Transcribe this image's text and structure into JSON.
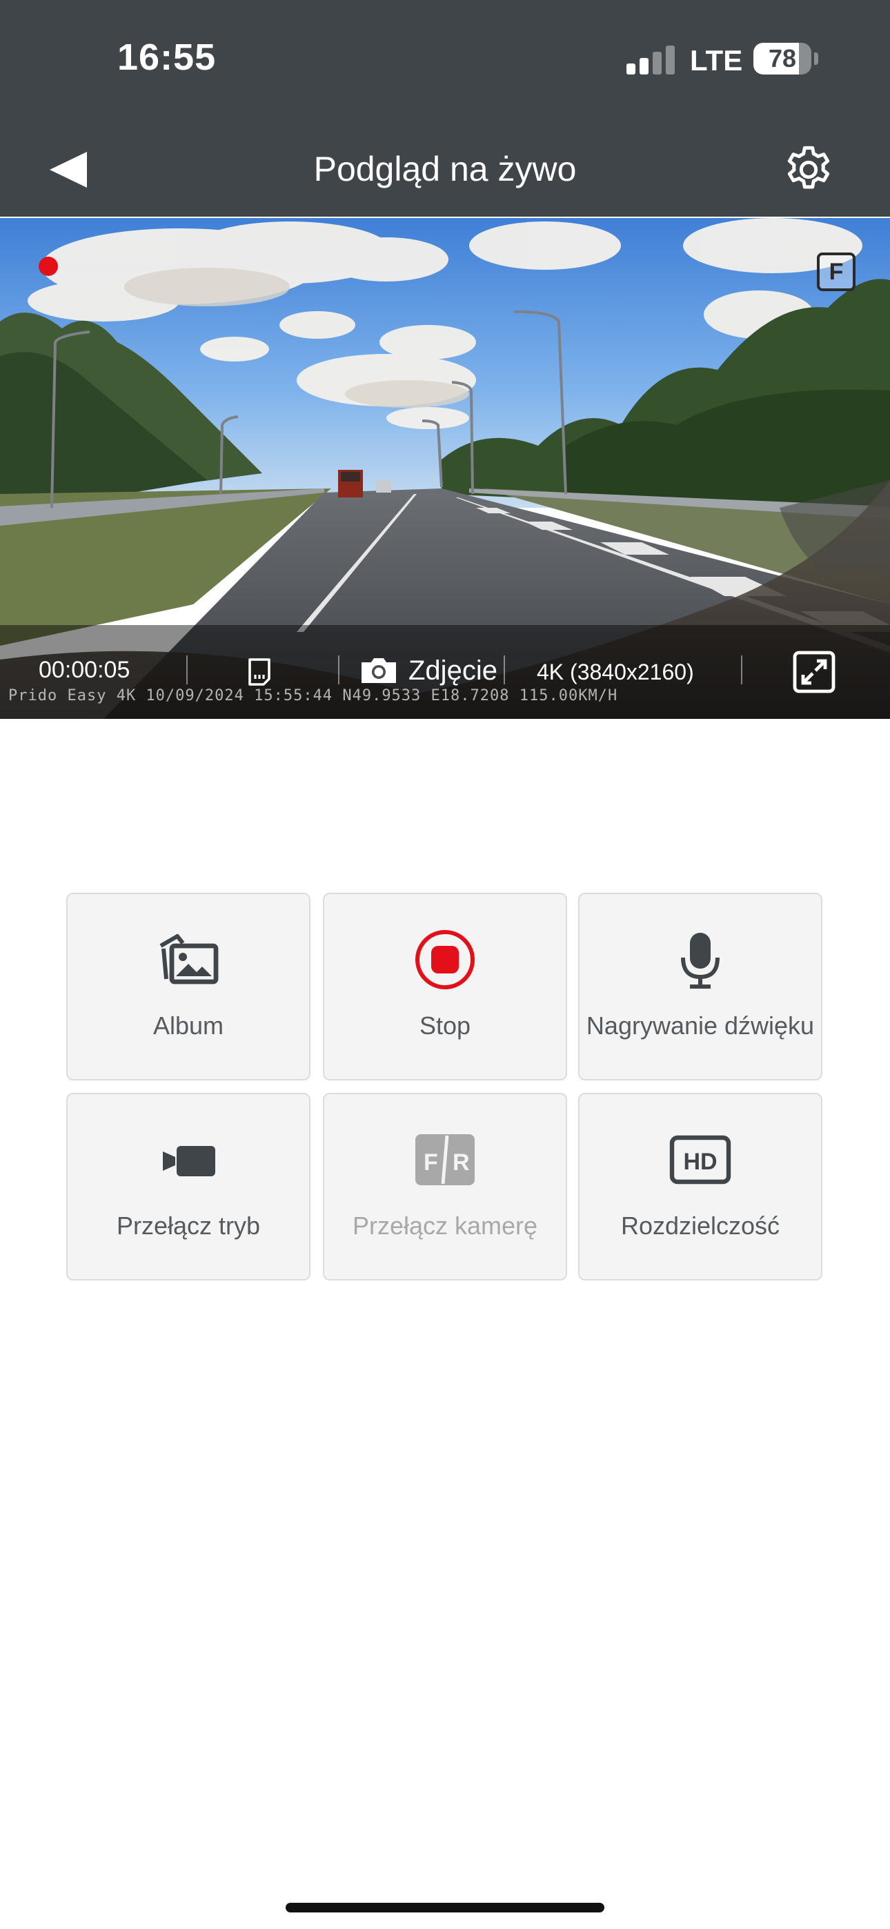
{
  "status_bar": {
    "time": "16:55",
    "network": "LTE",
    "battery": "78",
    "battery_level": 0.78,
    "signal_bars_active": 2,
    "signal_bars_total": 4
  },
  "nav": {
    "title": "Podgląd na żywo",
    "back_icon": "back-triangle-icon",
    "settings_icon": "gear-icon"
  },
  "preview": {
    "camera_badge": "F",
    "recording": true,
    "elapsed": "00:00:05",
    "photo_label": "Zdjęcie",
    "resolution": "4K (3840x2160)",
    "stamp": "Prido Easy 4K  10/09/2024  15:55:44  N49.9533  E18.7208  115.00KM/H"
  },
  "controls": [
    {
      "label": "Album",
      "icon": "album-icon",
      "enabled": true
    },
    {
      "label": "Stop",
      "icon": "stop-record-icon",
      "enabled": true
    },
    {
      "label": "Nagrywanie dźwięku",
      "icon": "microphone-icon",
      "enabled": true
    },
    {
      "label": "Przełącz tryb",
      "icon": "video-camera-icon",
      "enabled": true
    },
    {
      "label": "Przełącz kamerę",
      "icon": "front-rear-camera-icon",
      "enabled": false
    },
    {
      "label": "Rozdzielczość",
      "icon": "hd-icon",
      "enabled": true
    }
  ],
  "colors": {
    "header_bg": "#3f4548",
    "record_red": "#e3101a",
    "tile_bg": "#f4f4f4",
    "icon_dark": "#3f4548",
    "icon_disabled": "#a8a8a8"
  }
}
